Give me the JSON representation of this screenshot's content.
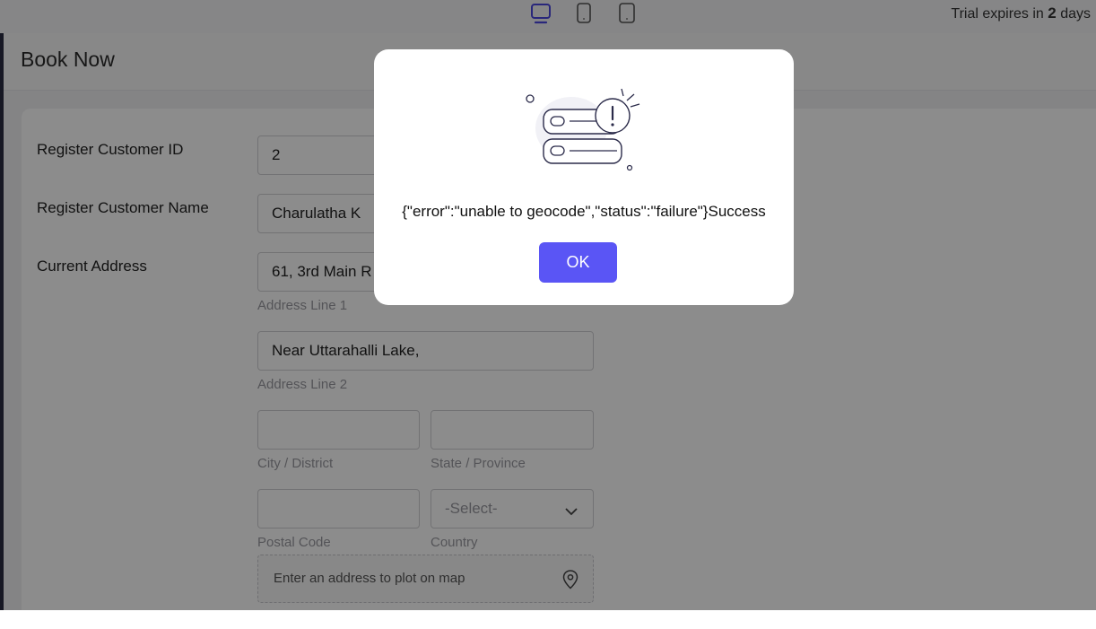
{
  "topbar": {
    "trial_prefix": "Trial expires in",
    "trial_days": "2",
    "trial_suffix": "days",
    "device_icons": [
      "desktop-icon",
      "tablet-icon",
      "mobile-icon"
    ]
  },
  "header": {
    "title": "Book Now"
  },
  "form": {
    "customer_id_label": "Register Customer ID",
    "customer_id_value": "2",
    "customer_name_label": "Register Customer Name",
    "customer_name_value": "Charulatha K",
    "address_label": "Current Address",
    "address_line1_value": "61, 3rd Main R",
    "address_line1_hint": "Address Line 1",
    "address_line2_value": "Near Uttarahalli Lake,",
    "address_line2_hint": "Address Line 2",
    "city_hint": "City / District",
    "state_hint": "State / Province",
    "postal_hint": "Postal Code",
    "country_value": "-Select-",
    "country_hint": "Country",
    "map_placeholder": "Enter an address to plot on map"
  },
  "modal": {
    "message": "{\"error\":\"unable to geocode\",\"status\":\"failure\"}Success",
    "ok_label": "OK"
  },
  "colors": {
    "accent": "#5a55f5",
    "sidebar": "#2b2d42"
  }
}
